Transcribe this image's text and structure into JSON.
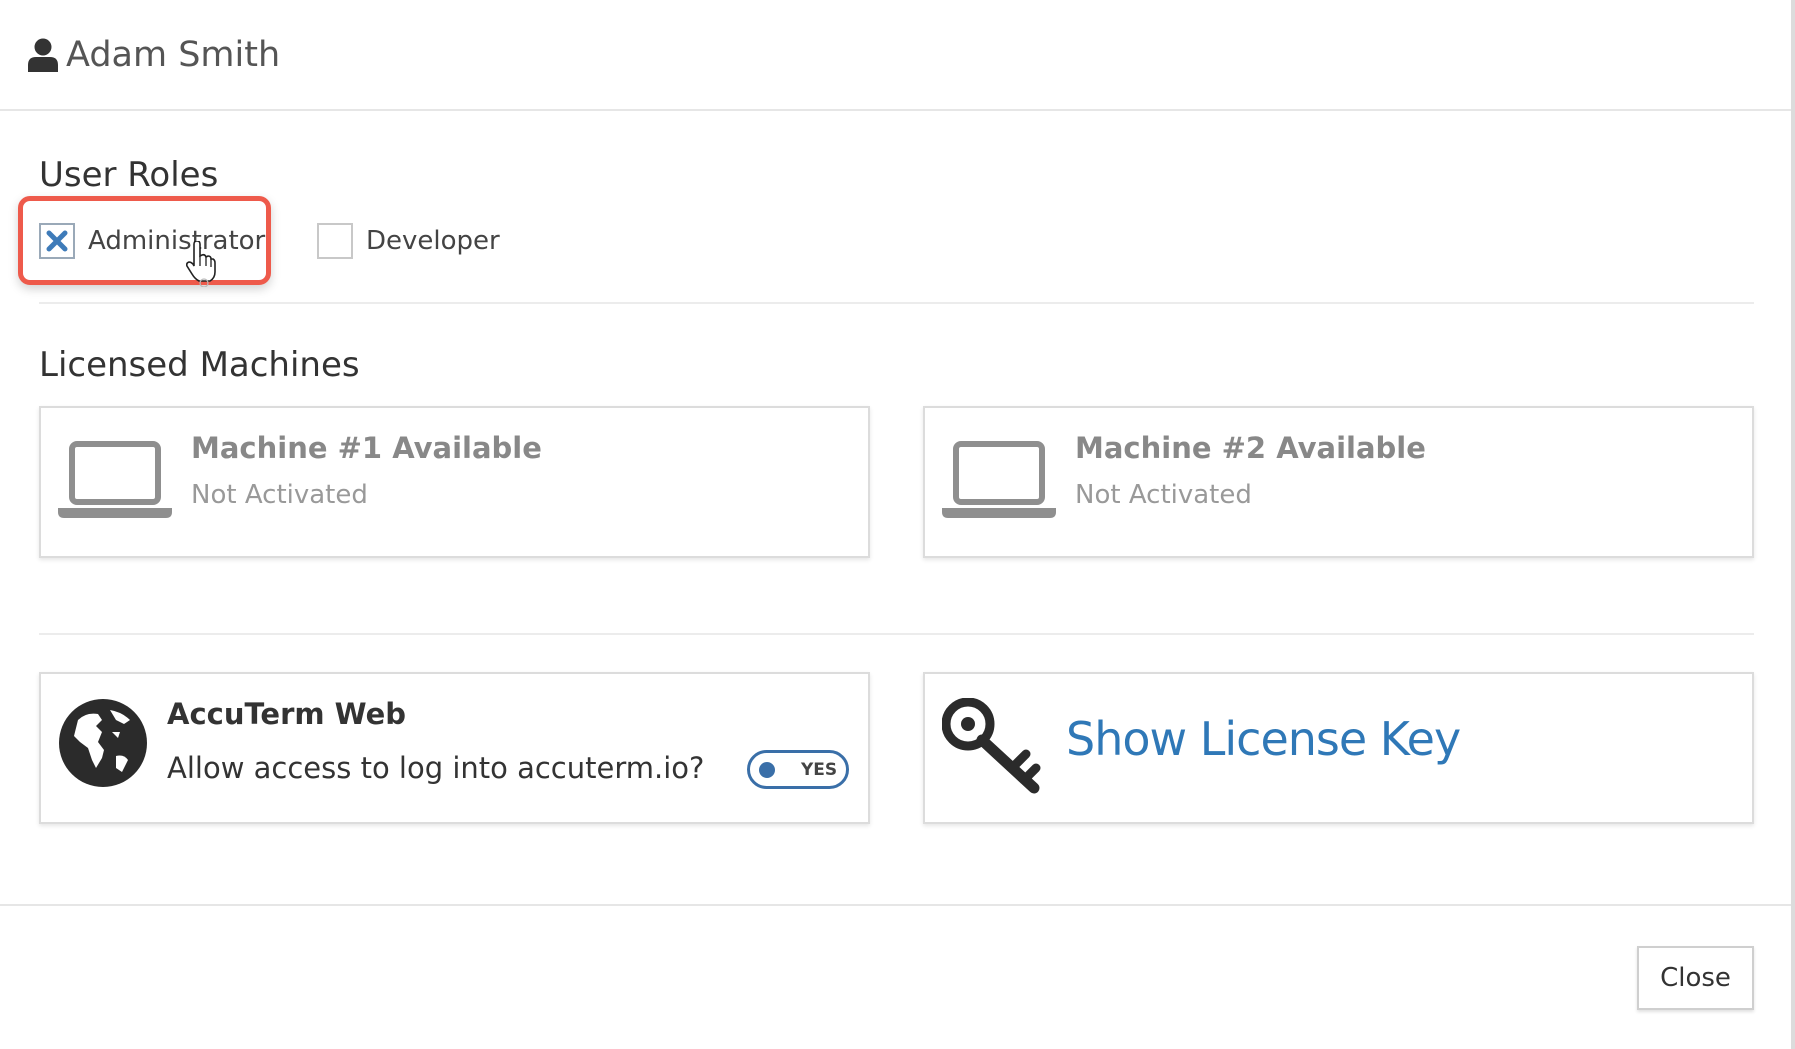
{
  "header": {
    "icon": "user-icon",
    "title": "Adam Smith"
  },
  "roles": {
    "title": "User Roles",
    "items": [
      {
        "label": "Administrator",
        "checked": true,
        "highlighted": true
      },
      {
        "label": "Developer",
        "checked": false
      }
    ]
  },
  "machines": {
    "title": "Licensed Machines",
    "items": [
      {
        "icon": "laptop-icon",
        "name": "Machine #1 Available",
        "status": "Not Activated"
      },
      {
        "icon": "laptop-icon",
        "name": "Machine #2 Available",
        "status": "Not Activated"
      }
    ]
  },
  "web_access": {
    "icon": "globe-icon",
    "title": "AccuTerm Web",
    "description": "Allow access to log into accuterm.io?",
    "toggle_label": "YES",
    "toggle_on": true
  },
  "license": {
    "icon": "key-icon",
    "link_label": "Show License Key"
  },
  "footer": {
    "close_label": "Close"
  },
  "colors": {
    "accent": "#2f78b7",
    "highlight": "#ee5a4b"
  }
}
